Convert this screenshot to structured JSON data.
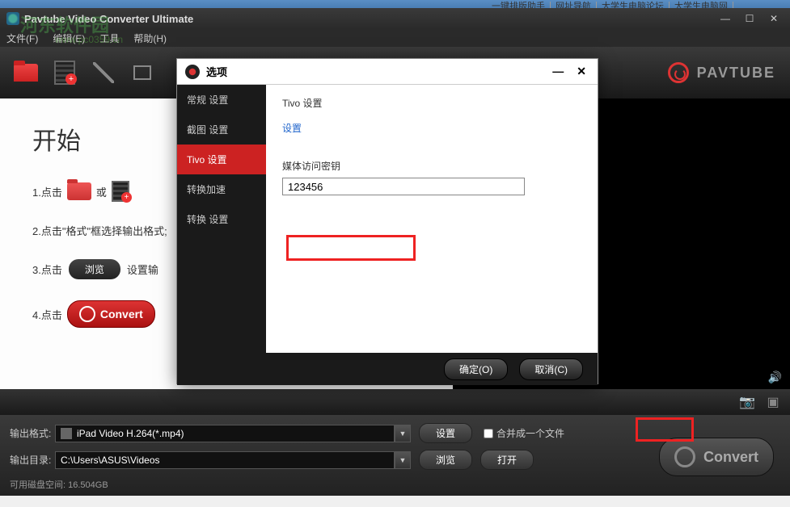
{
  "top_links": [
    "一键排版助手",
    "网址导航",
    "大学生电脑论坛",
    "大学生电脑网"
  ],
  "watermark": {
    "text": "河东软件园",
    "url": "www.pc0359.cn"
  },
  "app": {
    "title": "Pavtube Video Converter Ultimate",
    "menu": {
      "file": "文件(F)",
      "edit": "编辑(E)",
      "tools": "工具",
      "help": "帮助(H)"
    },
    "brand": "PAVTUBE"
  },
  "start": {
    "title": "开始",
    "step1_prefix": "1.点击",
    "step1_or": "或",
    "step2": "2.点击\"格式\"框选择输出格式;",
    "step3_prefix": "3.点击",
    "step3_browse": "浏览",
    "step3_suffix": "设置输",
    "step4_prefix": "4.点击",
    "convert_label": "Convert"
  },
  "bottom": {
    "format_label": "输出格式:",
    "format_value": "iPad Video H.264(*.mp4)",
    "settings_btn": "设置",
    "merge_label": "合并成一个文件",
    "output_label": "输出目录:",
    "output_value": "C:\\Users\\ASUS\\Videos",
    "browse_btn": "浏览",
    "open_btn": "打开",
    "disk_label": "可用磁盘空间:",
    "disk_value": "16.504GB",
    "big_convert": "Convert"
  },
  "dialog": {
    "title": "选项",
    "side": {
      "general": "常规 设置",
      "screenshot": "截图 设置",
      "tivo": "Tivo 设置",
      "accel": "转换加速",
      "convert": "转换 设置"
    },
    "content": {
      "heading": "Tivo 设置",
      "sub": "设置",
      "field_label": "媒体访问密钥",
      "field_value": "123456"
    },
    "ok": "确定(O)",
    "cancel": "取消(C)"
  }
}
